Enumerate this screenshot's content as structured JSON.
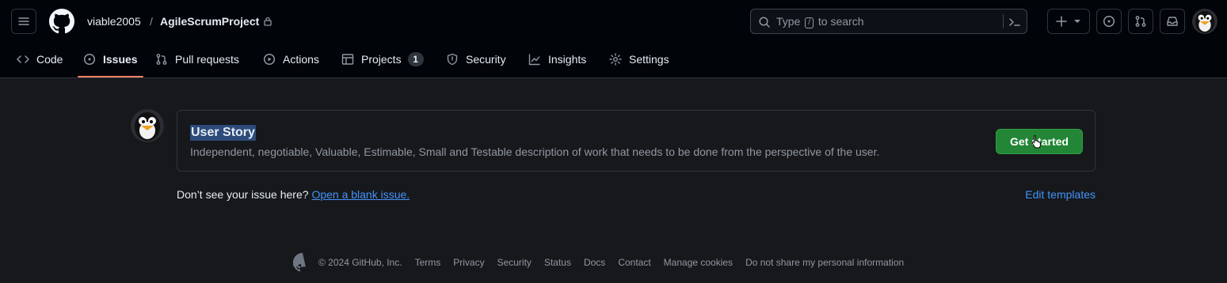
{
  "header": {
    "owner": "viable2005",
    "separator": "/",
    "repo": "AgileScrumProject",
    "search_placeholder_before": "Type",
    "search_key": "/",
    "search_placeholder_after": "to search"
  },
  "nav": {
    "tabs": [
      {
        "label": "Code",
        "icon": "code-icon"
      },
      {
        "label": "Issues",
        "icon": "issue-icon",
        "active": true
      },
      {
        "label": "Pull requests",
        "icon": "pull-request-icon"
      },
      {
        "label": "Actions",
        "icon": "play-icon"
      },
      {
        "label": "Projects",
        "icon": "table-icon",
        "counter": "1"
      },
      {
        "label": "Security",
        "icon": "shield-icon"
      },
      {
        "label": "Insights",
        "icon": "graph-icon"
      },
      {
        "label": "Settings",
        "icon": "gear-icon"
      }
    ]
  },
  "template": {
    "title": "User Story",
    "description": "Independent, negotiable, Valuable, Estimable, Small and Testable description of work that needs to be done from the perspective of the user.",
    "button": "Get started"
  },
  "blank": {
    "prompt": "Don’t see your issue here?",
    "link": "Open a blank issue.",
    "edit_templates": "Edit templates"
  },
  "footer": {
    "copyright": "© 2024 GitHub, Inc.",
    "links": [
      "Terms",
      "Privacy",
      "Security",
      "Status",
      "Docs",
      "Contact",
      "Manage cookies",
      "Do not share my personal information"
    ]
  },
  "colors": {
    "accent_underline": "#f78166",
    "primary_button": "#238636",
    "link": "#4493f8"
  }
}
